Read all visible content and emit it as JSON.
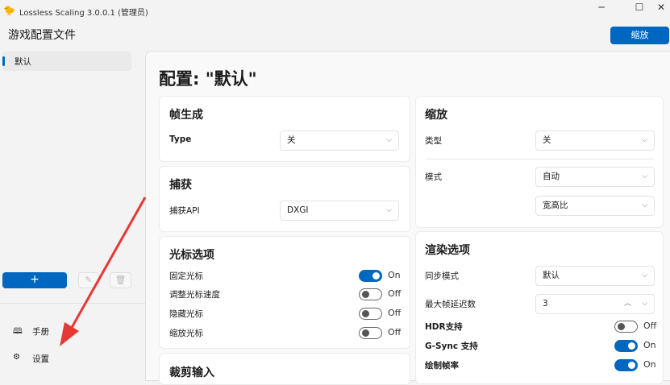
{
  "window": {
    "title": "Lossless Scaling 3.0.0.1 (管理员)",
    "minimize": "─",
    "maximize": "☐",
    "close": "✕"
  },
  "header": {
    "title": "游戏配置文件",
    "scale_button": "缩放"
  },
  "sidebar": {
    "profiles": [
      {
        "label": "默认",
        "selected": true
      }
    ],
    "add": "+",
    "bottom": [
      {
        "label": "手册",
        "icon": "book-icon"
      },
      {
        "label": "设置",
        "icon": "gear-icon"
      }
    ]
  },
  "main": {
    "title": "配置: \"默认\"",
    "frame_gen": {
      "heading": "帧生成",
      "type_label": "Type",
      "type_value": "关"
    },
    "capture": {
      "heading": "捕获",
      "api_label": "捕获API",
      "api_value": "DXGI"
    },
    "cursor": {
      "heading": "光标选项",
      "items": [
        {
          "label": "固定光标",
          "state": "On",
          "on": true
        },
        {
          "label": "调整光标速度",
          "state": "Off",
          "on": false
        },
        {
          "label": "隐藏光标",
          "state": "Off",
          "on": false
        },
        {
          "label": "缩放光标",
          "state": "Off",
          "on": false
        }
      ]
    },
    "crop": {
      "heading": "裁剪输入"
    },
    "scaling": {
      "heading": "缩放",
      "type_label": "类型",
      "type_value": "关",
      "mode_label": "模式",
      "mode_value": "自动",
      "aspect_value": "宽高比"
    },
    "render": {
      "heading": "渲染选项",
      "sync_label": "同步模式",
      "sync_value": "默认",
      "latency_label": "最大帧延迟数",
      "latency_value": "3",
      "toggles": [
        {
          "label": "HDR支持",
          "state": "Off",
          "on": false
        },
        {
          "label": "G-Sync 支持",
          "state": "On",
          "on": true
        },
        {
          "label": "绘制帧率",
          "state": "On",
          "on": true
        }
      ]
    }
  },
  "colors": {
    "accent": "#0067c0",
    "annotation": "#e53935"
  }
}
